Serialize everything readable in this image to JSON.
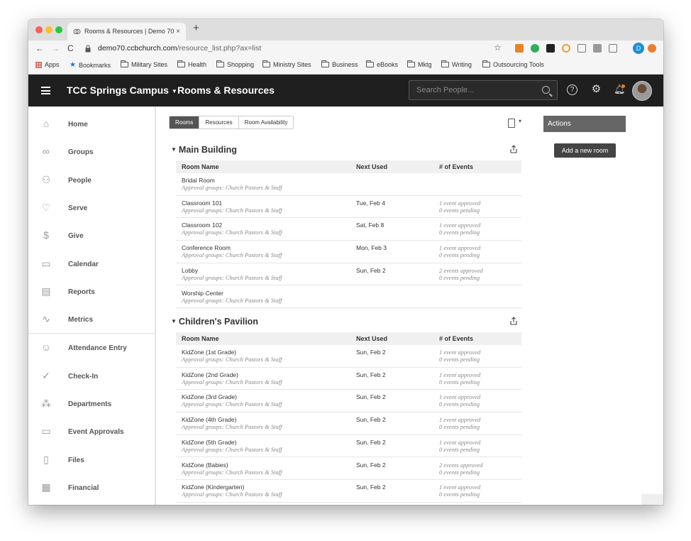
{
  "browser": {
    "tab_title": "Rooms & Resources | Demo 70",
    "tab_close": "×",
    "new_tab": "+",
    "back": "←",
    "forward": "→",
    "reload": "C",
    "url_host": "demo70.ccbchurch.com",
    "url_path": "/resource_list.php?ax=list",
    "bookmark_star": "☆",
    "profile_initial": "D",
    "bookmarks": [
      "Apps",
      "Bookmarks",
      "Military Sites",
      "Health",
      "Shopping",
      "Ministry Sites",
      "Business",
      "eBooks",
      "Mktg",
      "Writing",
      "Outsourcing Tools"
    ]
  },
  "header": {
    "campus": "TCC Springs Campus",
    "section": "Rooms & Resources",
    "search_placeholder": "Search People...",
    "help": "?",
    "gear": "⚙",
    "bell": "♫"
  },
  "sidebar": {
    "items": [
      {
        "label": "Home",
        "icon": "⌂"
      },
      {
        "label": "Groups",
        "icon": "∞"
      },
      {
        "label": "People",
        "icon": "⚇"
      },
      {
        "label": "Serve",
        "icon": "♡"
      },
      {
        "label": "Give",
        "icon": "$"
      },
      {
        "label": "Calendar",
        "icon": "▭"
      },
      {
        "label": "Reports",
        "icon": "▤"
      },
      {
        "label": "Metrics",
        "icon": "∿"
      },
      {
        "label": "Attendance Entry",
        "icon": "☺"
      },
      {
        "label": "Check-In",
        "icon": "✓"
      },
      {
        "label": "Departments",
        "icon": "⁂"
      },
      {
        "label": "Event Approvals",
        "icon": "▭"
      },
      {
        "label": "Files",
        "icon": "▯"
      },
      {
        "label": "Financial",
        "icon": "▦"
      }
    ]
  },
  "tabs": [
    "Rooms",
    "Resources",
    "Room Availability"
  ],
  "columns": {
    "room_name": "Room Name",
    "next_used": "Next Used",
    "events": "# of Events"
  },
  "groups": [
    {
      "title": "Main Building",
      "rows": [
        {
          "name": "Bridal Room",
          "approval": "Approval groups: Church Pastors & Staff",
          "next": "",
          "ev1": "",
          "ev2": ""
        },
        {
          "name": "Classroom 101",
          "approval": "Approval groups: Church Pastors & Staff",
          "next": "Tue, Feb 4",
          "ev1": "1 event approved",
          "ev2": "0 events pending"
        },
        {
          "name": "Classroom 102",
          "approval": "Approval groups: Church Pastors & Staff",
          "next": "Sat, Feb 8",
          "ev1": "1 event approved",
          "ev2": "0 events pending"
        },
        {
          "name": "Conference Room",
          "approval": "Approval groups: Church Pastors & Staff",
          "next": "Mon, Feb 3",
          "ev1": "1 event approved",
          "ev2": "0 events pending"
        },
        {
          "name": "Lobby",
          "approval": "Approval groups: Church Pastors & Staff",
          "next": "Sun, Feb 2",
          "ev1": "2 events approved",
          "ev2": "0 events pending"
        },
        {
          "name": "Worship Center",
          "approval": "Approval groups: Church Pastors & Staff",
          "next": "",
          "ev1": "",
          "ev2": ""
        }
      ]
    },
    {
      "title": "Children's Pavilion",
      "rows": [
        {
          "name": "KidZone (1st Grade)",
          "approval": "Approval groups: Church Pastors & Staff",
          "next": "Sun, Feb 2",
          "ev1": "1 event approved",
          "ev2": "0 events pending"
        },
        {
          "name": "KidZone (2nd Grade)",
          "approval": "Approval groups: Church Pastors & Staff",
          "next": "Sun, Feb 2",
          "ev1": "1 event approved",
          "ev2": "0 events pending"
        },
        {
          "name": "KidZone (3rd Grade)",
          "approval": "Approval groups: Church Pastors & Staff",
          "next": "Sun, Feb 2",
          "ev1": "1 event approved",
          "ev2": "0 events pending"
        },
        {
          "name": "KidZone (4th Grade)",
          "approval": "Approval groups: Church Pastors & Staff",
          "next": "Sun, Feb 2",
          "ev1": "1 event approved",
          "ev2": "0 events pending"
        },
        {
          "name": "KidZone (5th Grade)",
          "approval": "Approval groups: Church Pastors & Staff",
          "next": "Sun, Feb 2",
          "ev1": "1 event approved",
          "ev2": "0 events pending"
        },
        {
          "name": "KidZone (Babies)",
          "approval": "Approval groups: Church Pastors & Staff",
          "next": "Sun, Feb 2",
          "ev1": "2 events approved",
          "ev2": "0 events pending"
        },
        {
          "name": "KidZone (Kindergarten)",
          "approval": "Approval groups: Church Pastors & Staff",
          "next": "Sun, Feb 2",
          "ev1": "1 event approved",
          "ev2": "0 events pending"
        }
      ]
    }
  ],
  "actions": {
    "title": "Actions",
    "add_room": "Add a new room"
  }
}
